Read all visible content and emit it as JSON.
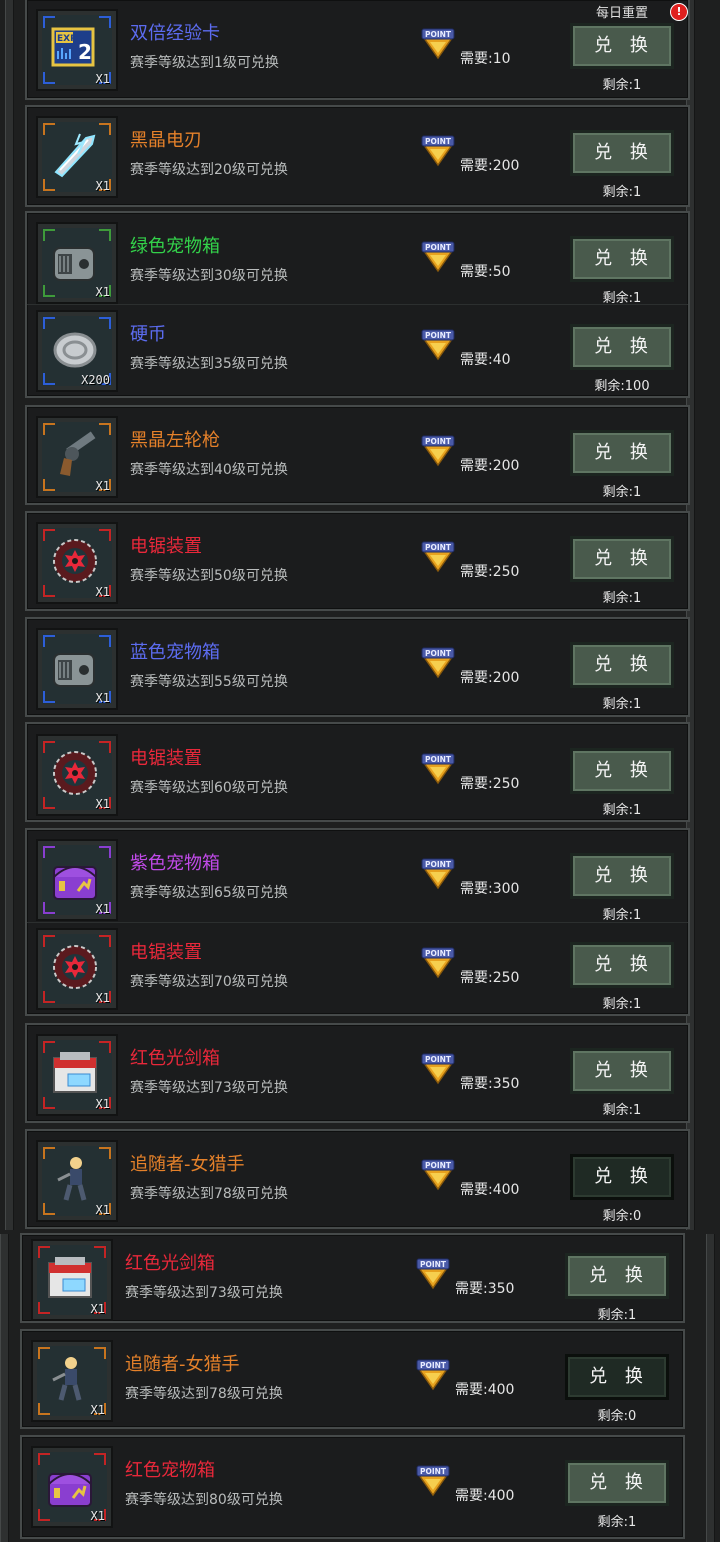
{
  "colors": {
    "blue": "#5c6cf0",
    "orange": "#e5812a",
    "green": "#33d14a",
    "red": "#e8283a",
    "purple": "#c04ae8",
    "corner_blue": "#2d5ed8",
    "corner_orange": "#c8741e",
    "corner_green": "#3f9a3a",
    "corner_red": "#c42424",
    "corner_purple": "#8a3ed0"
  },
  "daily_reset_label": "每日重置",
  "badge_label": "!",
  "items": [
    {
      "name": "双倍经验卡",
      "rarity": "blue",
      "icon": "exp-card-icon",
      "qty": "X1",
      "requirement": "赛季等级达到1级可兑换",
      "cost": "需要:10",
      "button": "兑 换",
      "remaining": "剩余:1",
      "button_state": "enabled"
    },
    {
      "name": "黑晶电刃",
      "rarity": "orange",
      "icon": "electric-blade-icon",
      "qty": "X1",
      "requirement": "赛季等级达到20级可兑换",
      "cost": "需要:200",
      "button": "兑 换",
      "remaining": "剩余:1",
      "button_state": "enabled"
    },
    {
      "name": "绿色宠物箱",
      "rarity": "green",
      "icon": "pet-crate-icon",
      "qty": "X1",
      "requirement": "赛季等级达到30级可兑换",
      "cost": "需要:50",
      "button": "兑 换",
      "remaining": "剩余:1",
      "button_state": "enabled"
    },
    {
      "name": "硬币",
      "rarity": "blue",
      "icon": "coin-icon",
      "qty": "X200",
      "requirement": "赛季等级达到35级可兑换",
      "cost": "需要:40",
      "button": "兑 换",
      "remaining": "剩余:100",
      "button_state": "enabled"
    },
    {
      "name": "黑晶左轮枪",
      "rarity": "orange",
      "icon": "revolver-icon",
      "qty": "X1",
      "requirement": "赛季等级达到40级可兑换",
      "cost": "需要:200",
      "button": "兑 换",
      "remaining": "剩余:1",
      "button_state": "enabled"
    },
    {
      "name": "电锯装置",
      "rarity": "red",
      "icon": "sawblade-icon",
      "qty": "X1",
      "requirement": "赛季等级达到50级可兑换",
      "cost": "需要:250",
      "button": "兑 换",
      "remaining": "剩余:1",
      "button_state": "enabled"
    },
    {
      "name": "蓝色宠物箱",
      "rarity": "blue",
      "icon": "pet-crate-icon",
      "qty": "X1",
      "requirement": "赛季等级达到55级可兑换",
      "cost": "需要:200",
      "button": "兑 换",
      "remaining": "剩余:1",
      "button_state": "enabled"
    },
    {
      "name": "电锯装置",
      "rarity": "red",
      "icon": "sawblade-icon",
      "qty": "X1",
      "requirement": "赛季等级达到60级可兑换",
      "cost": "需要:250",
      "button": "兑 换",
      "remaining": "剩余:1",
      "button_state": "enabled"
    },
    {
      "name": "紫色宠物箱",
      "rarity": "purple",
      "icon": "pet-chest-icon",
      "qty": "X1",
      "requirement": "赛季等级达到65级可兑换",
      "cost": "需要:300",
      "button": "兑 换",
      "remaining": "剩余:1",
      "button_state": "enabled"
    },
    {
      "name": "电锯装置",
      "rarity": "red",
      "icon": "sawblade-icon",
      "qty": "X1",
      "requirement": "赛季等级达到70级可兑换",
      "cost": "需要:250",
      "button": "兑 换",
      "remaining": "剩余:1",
      "button_state": "enabled"
    },
    {
      "name": "红色光剑箱",
      "rarity": "red",
      "icon": "lightsaber-box-icon",
      "qty": "X1",
      "requirement": "赛季等级达到73级可兑换",
      "cost": "需要:350",
      "button": "兑 换",
      "remaining": "剩余:1",
      "button_state": "enabled"
    },
    {
      "name": "追随者-女猎手",
      "rarity": "orange",
      "icon": "huntress-icon",
      "qty": "X1",
      "requirement": "赛季等级达到78级可兑换",
      "cost": "需要:400",
      "button": "兑 换",
      "remaining": "剩余:0",
      "button_state": "disabled"
    },
    {
      "name": "红色光剑箱",
      "rarity": "red",
      "icon": "lightsaber-box-icon",
      "qty": "X1",
      "requirement": "赛季等级达到73级可兑换",
      "cost": "需要:350",
      "button": "兑 换",
      "remaining": "剩余:1",
      "button_state": "enabled"
    },
    {
      "name": "追随者-女猎手",
      "rarity": "orange",
      "icon": "huntress-icon",
      "qty": "X1",
      "requirement": "赛季等级达到78级可兑换",
      "cost": "需要:400",
      "button": "兑 换",
      "remaining": "剩余:0",
      "button_state": "disabled"
    },
    {
      "name": "红色宠物箱",
      "rarity": "red",
      "icon": "pet-chest-icon",
      "qty": "X1",
      "requirement": "赛季等级达到80级可兑换",
      "cost": "需要:400",
      "button": "兑 换",
      "remaining": "剩余:1",
      "button_state": "enabled"
    }
  ]
}
